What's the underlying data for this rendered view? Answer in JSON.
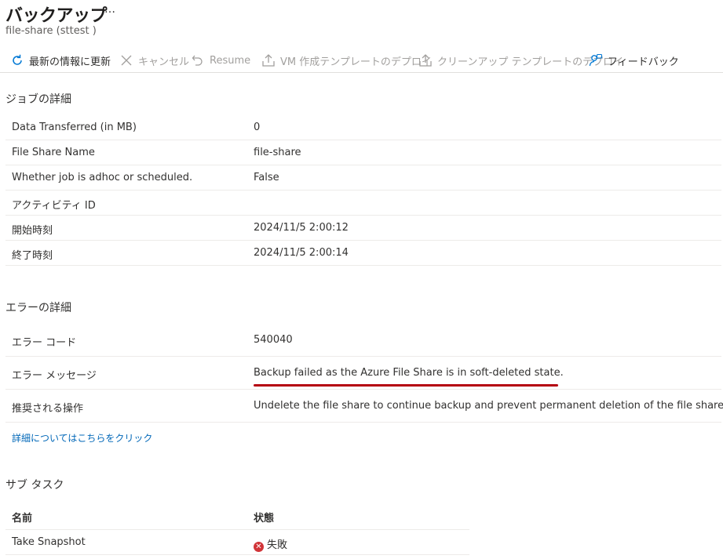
{
  "header": {
    "title": "バックアップ",
    "more": "…",
    "subtitle": "file-share (sttest                    )"
  },
  "toolbar": {
    "refresh": "最新の情報に更新",
    "cancel": "キャンセル",
    "resume": "Resume",
    "vm_template": "VM 作成テンプレートのデプロイ",
    "cleanup_template": "クリーンアップ テンプレートのデプロイ",
    "feedback": "フィードバック"
  },
  "job": {
    "heading": "ジョブの詳細",
    "rows": [
      {
        "key": "Data Transferred (in MB)",
        "value": "0"
      },
      {
        "key": "File Share Name",
        "value": "file-share"
      },
      {
        "key": "Whether job is adhoc or scheduled.",
        "value": "False"
      },
      {
        "key": "アクティビティ ID",
        "value": ""
      },
      {
        "key": "開始時刻",
        "value": "2024/11/5 2:00:12"
      },
      {
        "key": "終了時刻",
        "value": "2024/11/5 2:00:14"
      }
    ]
  },
  "error": {
    "heading": "エラーの詳細",
    "rows": [
      {
        "key": "エラー コード",
        "value": "540040"
      },
      {
        "key": "エラー メッセージ",
        "value": "Backup failed as the Azure File Share is in soft-deleted state."
      },
      {
        "key": "推奨される操作",
        "value": "Undelete the file share to continue backup and prevent permanent deletion of the file share."
      }
    ],
    "link": "詳細についてはこちらをクリック"
  },
  "subtasks": {
    "heading": "サブ タスク",
    "columns": [
      "名前",
      "状態"
    ],
    "rows": [
      {
        "name": "Take Snapshot",
        "status": "失敗"
      }
    ]
  },
  "colors": {
    "link": "#0067b8",
    "error_icon": "#d13438",
    "highlight_line": "#b4000f"
  }
}
